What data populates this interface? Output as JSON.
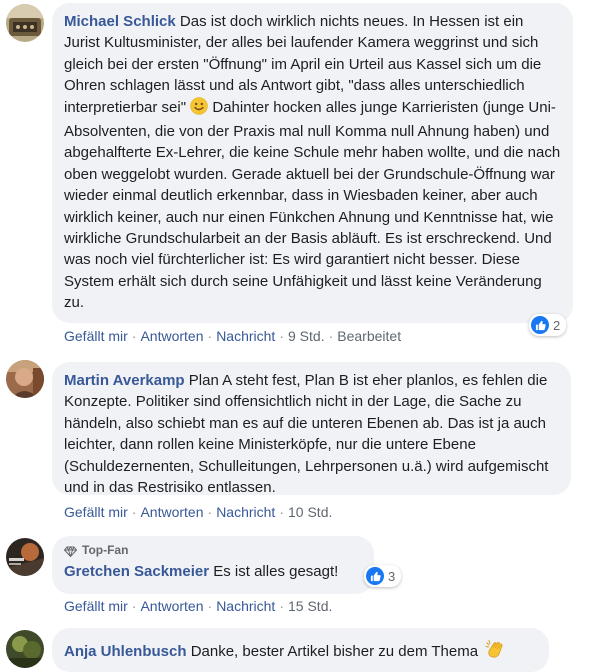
{
  "comments": [
    {
      "author": "Michael Schlick",
      "text": "Das ist doch wirklich nichts neues. In Hessen ist ein Jurist Kultusminister, der alles bei laufender Kamera weggrinst und sich gleich bei der ersten \"Öffnung\" im April ein Urteil aus Kassel sich um die Ohren schlagen lässt und als Antwort gibt, \"dass alles unterschiedlich interpretierbar sei\"",
      "emoji": "slightly-smiling-face",
      "text_after_emoji": " Dahinter hocken alles junge Karrieristen (junge Uni-Absolventen, die von der Praxis mal null Komma null Ahnung haben) und abgehalfterte Ex-Lehrer, die keine Schule mehr haben wollte, und die nach oben weggelobt wurden. Gerade aktuell bei der Grundschule-Öffnung war wieder einmal deutlich erkennbar, dass in Wiesbaden keiner, aber auch wirklich keiner, auch nur einen Fünkchen Ahnung und Kenntnisse hat, wie wirkliche Grundschularbeit an der Basis abläuft. Es ist erschreckend. Und was noch viel fürchterlicher ist: Es wird garantiert nicht besser. Diese System erhält sich durch seine Unfähigkeit und lässt keine Veränderung zu.",
      "like": "Gefällt mir",
      "reply": "Antworten",
      "message": "Nachricht",
      "time": "9 Std.",
      "edited": "Bearbeitet",
      "reaction_count": "2",
      "reaction_icon": "like-icon"
    },
    {
      "author": "Martin Averkamp",
      "text": "Plan A steht fest, Plan B ist eher planlos, es fehlen die Konzepte. Politiker sind offensichtlich nicht in der Lage, die Sache zu händeln, also schiebt man es auf die unteren Ebenen ab. Das ist ja auch leichter, dann rollen keine Ministerköpfe, nur die untere Ebene (Schuldezernenten, Schulleitungen, Lehrpersonen u.ä.) wird aufgemischt und in das Restrisiko entlassen.",
      "like": "Gefällt mir",
      "reply": "Antworten",
      "message": "Nachricht",
      "time": "10 Std."
    },
    {
      "badge": "Top-Fan",
      "badge_icon": "diamond-icon",
      "author": "Gretchen Sackmeier",
      "text": "Es ist alles gesagt!",
      "like": "Gefällt mir",
      "reply": "Antworten",
      "message": "Nachricht",
      "time": "15 Std.",
      "reaction_count": "3",
      "reaction_icon": "like-icon"
    },
    {
      "author": "Anja Uhlenbusch",
      "text": "Danke, bester Artikel bisher zu dem Thema",
      "emoji": "clapping-hands"
    }
  ],
  "colors": {
    "author": "#385898",
    "bubble": "#f0f2f5",
    "meta": "#606770",
    "like_blue": "#1877f2"
  }
}
